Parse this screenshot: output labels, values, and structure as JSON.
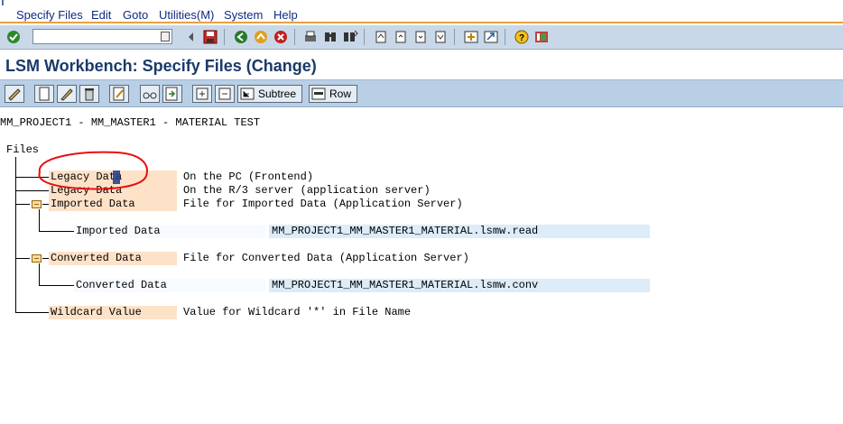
{
  "menu": {
    "items": [
      "Specify Files",
      "Edit",
      "Goto",
      "Utilities(M)",
      "System",
      "Help"
    ]
  },
  "toolbar": {
    "command_field_value": ""
  },
  "title": "LSM Workbench: Specify Files (Change)",
  "appbar": {
    "subtree_label": "Subtree",
    "row_label": "Row"
  },
  "header_line": "MM_PROJECT1 - MM_MASTER1 - MATERIAL TEST",
  "tree": {
    "root": "Files",
    "nodes": [
      {
        "label": "Legacy Data",
        "description": "On the PC (Frontend)"
      },
      {
        "label": "Legacy Data",
        "description": "On the R/3 server (application server)"
      },
      {
        "label": "Imported Data",
        "description": "File for Imported Data (Application Server)",
        "child": {
          "label": "Imported Data",
          "value": "MM_PROJECT1_MM_MASTER1_MATERIAL.lsmw.read"
        }
      },
      {
        "label": "Converted Data",
        "description": "File for Converted Data (Application Server)",
        "child": {
          "label": "Converted Data",
          "value": "MM_PROJECT1_MM_MASTER1_MATERIAL.lsmw.conv"
        }
      },
      {
        "label": "Wildcard Value",
        "description": "Value for Wildcard '*' in File Name"
      }
    ]
  },
  "colors": {
    "highlight_orange": "#fde2c8",
    "highlight_blue": "#dcecf8",
    "annotation_red": "#e81010",
    "title_text": "#1a3a6a"
  }
}
